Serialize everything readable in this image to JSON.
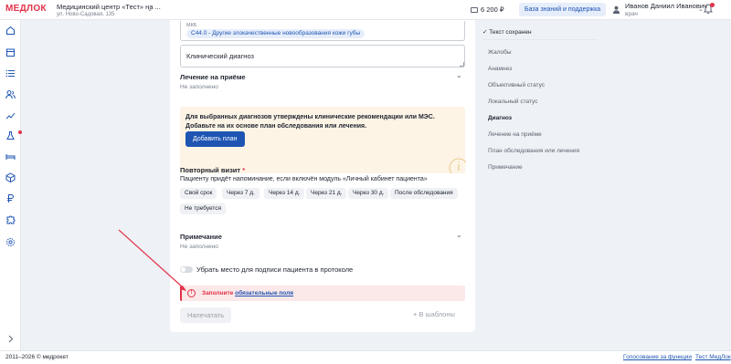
{
  "header": {
    "logo": "МЕДЛОК",
    "clinic_name": "Медицинский центр «Тест» на ...",
    "clinic_address": "ул. Ново-Садовая, 135",
    "balance": "6 200 ₽",
    "knowledge_base": "База знаний и поддержка",
    "user_name": "Иванов Даниил Иванович",
    "user_role": "врач"
  },
  "form": {
    "mkb_label": "МКБ",
    "mkb_chip": "C44.0 - Другие злокачественные новообразования кожи губы",
    "clinical_diagnosis": "Клинический диагноз",
    "treatment": {
      "title": "Лечение на приёме",
      "value": "Не заполнено"
    },
    "notice": {
      "text": "Для выбранных диагнозов утверждены клинические рекомендации или МЭС. Добавьте на их основе план обследования или лечения.",
      "button": "Добавить план"
    },
    "repeat_visit": {
      "title": "Повторный визит",
      "required": "*",
      "subtitle": "Пациенту придёт напоминание, если включён модуль «Личный кабинет пациента»",
      "options": [
        "Свой срок",
        "Через 7 д.",
        "Через 14 д.",
        "Через 21 д.",
        "Через 30 д.",
        "После обследования",
        "Не требуется"
      ]
    },
    "note": {
      "title": "Примечание",
      "value": "Не заполнено"
    },
    "toggle_label": "Убрать место для подписи пациента в протоколе",
    "alert": {
      "prefix": "Заполните",
      "link": "обязательные поля"
    },
    "print_button": "Напечатать",
    "template_button": "В шаблоны"
  },
  "right_panel": {
    "saved": "Текст сохранен",
    "items": [
      "Жалобы",
      "Анамнез",
      "Объективный статус",
      "Локальный статус",
      "Диагноз",
      "Лечение на приёме",
      "План обследования или лечения",
      "Примечание"
    ],
    "active": "Диагноз"
  },
  "footer": {
    "copyright": "2011–2026 © медрокет",
    "link1": "Голосование за функции",
    "link2": "Тест МедЛок"
  },
  "colors": {
    "accent": "#1e55b3",
    "brand": "#e2334a",
    "alert_bg": "#fbe8e8",
    "notice_bg": "#fdf4e6"
  }
}
